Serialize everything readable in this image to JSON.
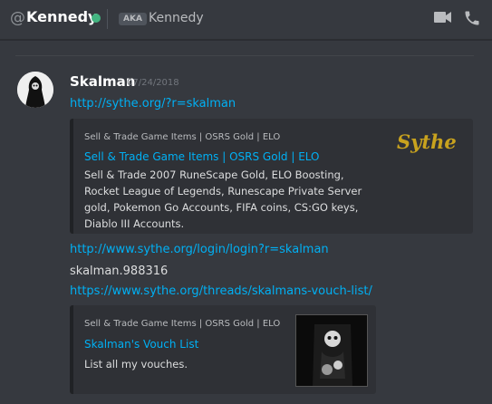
{
  "header": {
    "at_symbol": "@",
    "username": "Kennedy",
    "status_color": "#43b581",
    "aka_badge": "AKA",
    "aka_name": "Kennedy",
    "icons": [
      "video-call-icon",
      "voice-call-icon"
    ]
  },
  "message": {
    "author": "Skalman",
    "timestamp": "07/24/2018",
    "link1": "http://sythe.org/?r=skalman",
    "link2": "http://www.sythe.org/login/login?r=skalman",
    "text_line": "skalman.988316",
    "link3": "https://www.sythe.org/threads/skalmans-vouch-list/"
  },
  "embed1": {
    "provider": "Sell & Trade Game Items | OSRS Gold | ELO",
    "title": "Sell & Trade Game Items | OSRS Gold | ELO",
    "description_lines": [
      "Sell & Trade 2007 RuneScape Gold, ELO Boosting,",
      "Rocket League of Legends, Runescape Private Server",
      "gold, Pokemon Go Accounts, FIFA coins, CS:GO keys,",
      "Diablo III Accounts."
    ],
    "logo_text": "Sythe",
    "logo_color": "#c8a21e"
  },
  "embed2": {
    "provider": "Sell & Trade Game Items | OSRS Gold | ELO",
    "title": "Skalman's Vouch List",
    "description": "List all my vouches."
  }
}
